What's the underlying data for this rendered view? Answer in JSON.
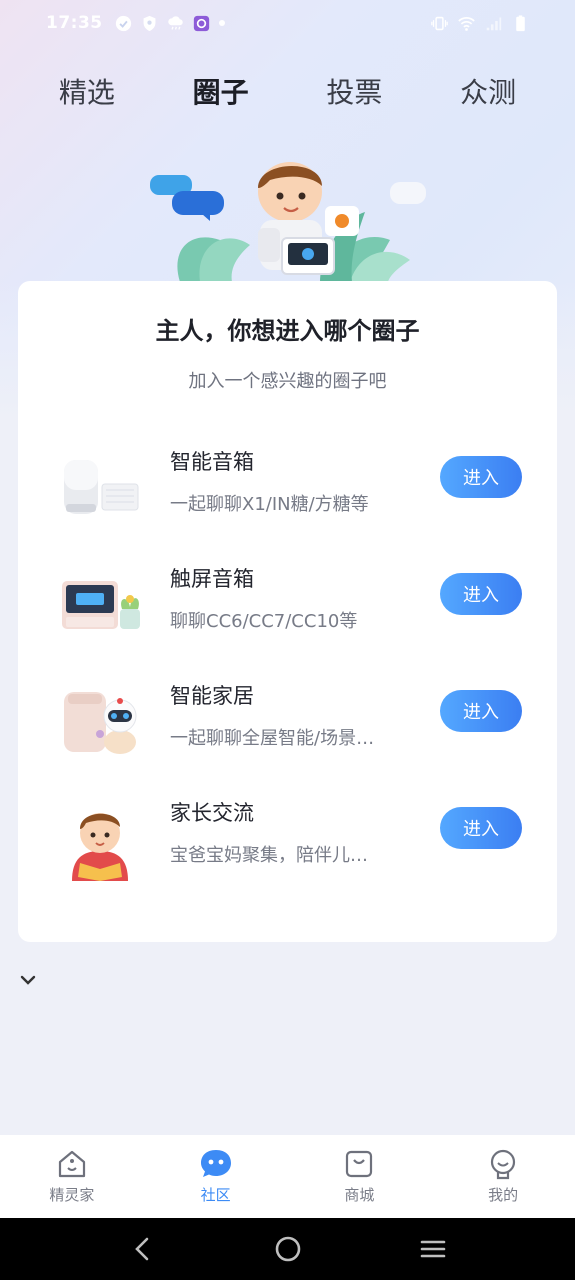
{
  "status_bar": {
    "time": "17:35",
    "left_icons": [
      "check-circle-icon",
      "shield-icon",
      "cloud-rain-icon",
      "app-notification-icon",
      "dot-icon"
    ],
    "right_icons": [
      "vibrate-icon",
      "wifi-icon",
      "signal-icon",
      "battery-icon"
    ]
  },
  "tabs": [
    {
      "label": "精选",
      "active": false
    },
    {
      "label": "圈子",
      "active": true
    },
    {
      "label": "投票",
      "active": false
    },
    {
      "label": "众测",
      "active": false
    }
  ],
  "card": {
    "title": "主人，你想进入哪个圈子",
    "subtitle": "加入一个感兴趣的圈子吧",
    "circles": [
      {
        "name": "智能音箱",
        "desc": "一起聊聊X1/IN糖/方糖等",
        "button": "进入",
        "icon": "smart-speaker-icon"
      },
      {
        "name": "触屏音箱",
        "desc": "聊聊CC6/CC7/CC10等",
        "button": "进入",
        "icon": "touchscreen-speaker-icon"
      },
      {
        "name": "智能家居",
        "desc": "一起聊聊全屋智能/场景…",
        "button": "进入",
        "icon": "smart-home-icon"
      },
      {
        "name": "家长交流",
        "desc": "宝爸宝妈聚集，陪伴儿…",
        "button": "进入",
        "icon": "parent-child-icon"
      }
    ]
  },
  "bottom_nav": [
    {
      "label": "精灵家",
      "icon": "home-icon",
      "active": false
    },
    {
      "label": "社区",
      "icon": "community-icon",
      "active": true
    },
    {
      "label": "商城",
      "icon": "shopping-bag-icon",
      "active": false
    },
    {
      "label": "我的",
      "icon": "profile-icon",
      "active": false
    }
  ],
  "colors": {
    "accent": "#3d8bf5",
    "button_gradient_start": "#54a8ff",
    "button_gradient_end": "#3b7ef2"
  }
}
